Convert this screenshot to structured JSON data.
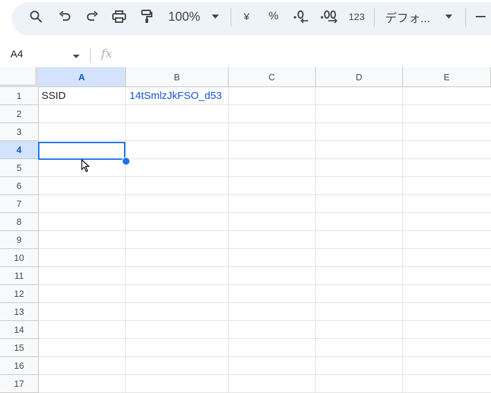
{
  "toolbar": {
    "zoom": "100%",
    "currency_symbol": "¥",
    "percent_symbol": "%",
    "number_format": "123",
    "font": "デフォ..."
  },
  "formula_bar": {
    "name_box": "A4",
    "fx_label": "fx",
    "value": ""
  },
  "grid": {
    "columns": [
      "A",
      "B",
      "C",
      "D",
      "E"
    ],
    "rows": [
      "1",
      "2",
      "3",
      "4",
      "5",
      "6",
      "7",
      "8",
      "9",
      "10",
      "11",
      "12",
      "13",
      "14",
      "15",
      "16",
      "17"
    ],
    "selected_cell": "A4",
    "cells": {
      "A1": "SSID",
      "B1": "14tSmlzJkFSO_d53"
    }
  },
  "colors": {
    "selection": "#1a73e8",
    "header_selected_bg": "#d3e3fd",
    "link_text": "#1155cc"
  }
}
